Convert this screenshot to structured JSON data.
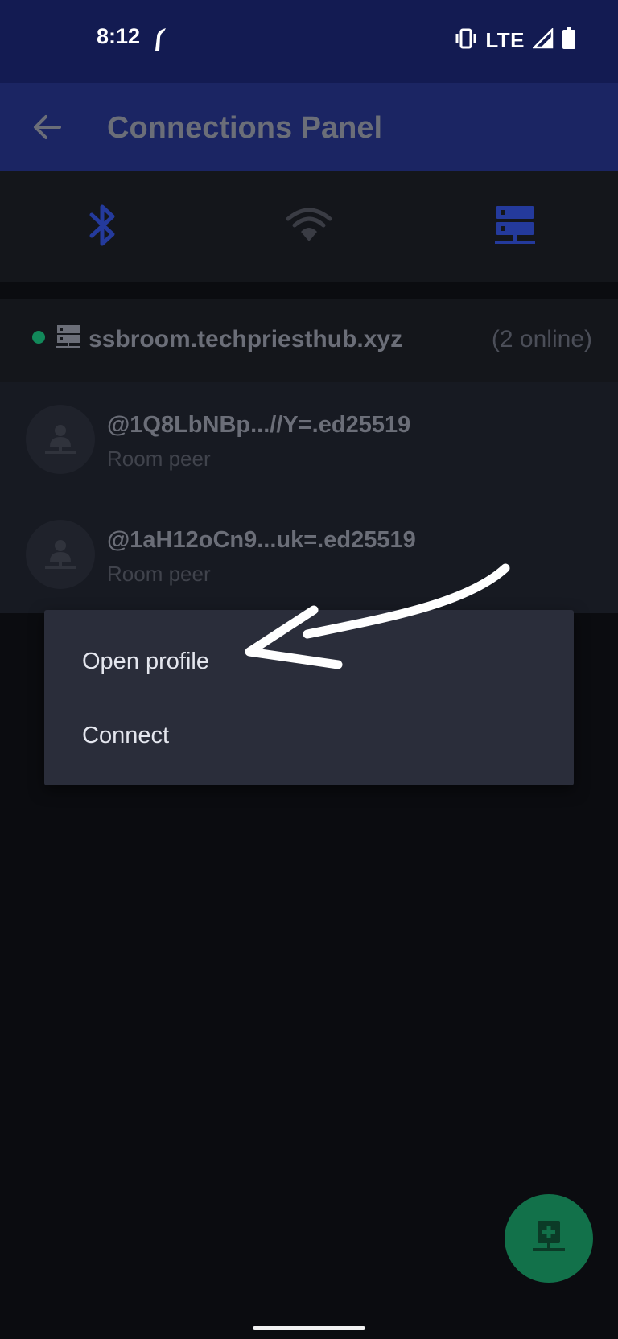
{
  "status_bar": {
    "time": "8:12",
    "network": "LTE",
    "icons": [
      "notification-icon",
      "vibrate-icon",
      "signal-icon",
      "battery-icon"
    ]
  },
  "app_bar": {
    "title": "Connections Panel",
    "back_icon": "back-arrow-icon"
  },
  "tabs": [
    {
      "name": "bluetooth",
      "icon": "bluetooth-icon",
      "selected": false
    },
    {
      "name": "wifi",
      "icon": "wifi-icon",
      "selected": false
    },
    {
      "name": "rooms",
      "icon": "server-icon",
      "selected": true
    }
  ],
  "room": {
    "name": "ssbroom.techpriesthub.xyz",
    "online": "(2 online)",
    "status_color": "#12885a"
  },
  "peers": [
    {
      "id": "@1Q8LbNBp...//Y=.ed25519",
      "subtitle": "Room peer"
    },
    {
      "id": "@1aH12oCn9...uk=.ed25519",
      "subtitle": "Room peer"
    }
  ],
  "menu": {
    "items": [
      {
        "label": "Open profile"
      },
      {
        "label": "Connect"
      }
    ]
  },
  "fab": {
    "icon": "add-server-icon"
  },
  "colors": {
    "status_bar": "#131b52",
    "app_bar": "#1b2563",
    "accent_blue": "#2a3fa8",
    "fab": "#12714a",
    "menu_bg": "#2a2d3a"
  }
}
